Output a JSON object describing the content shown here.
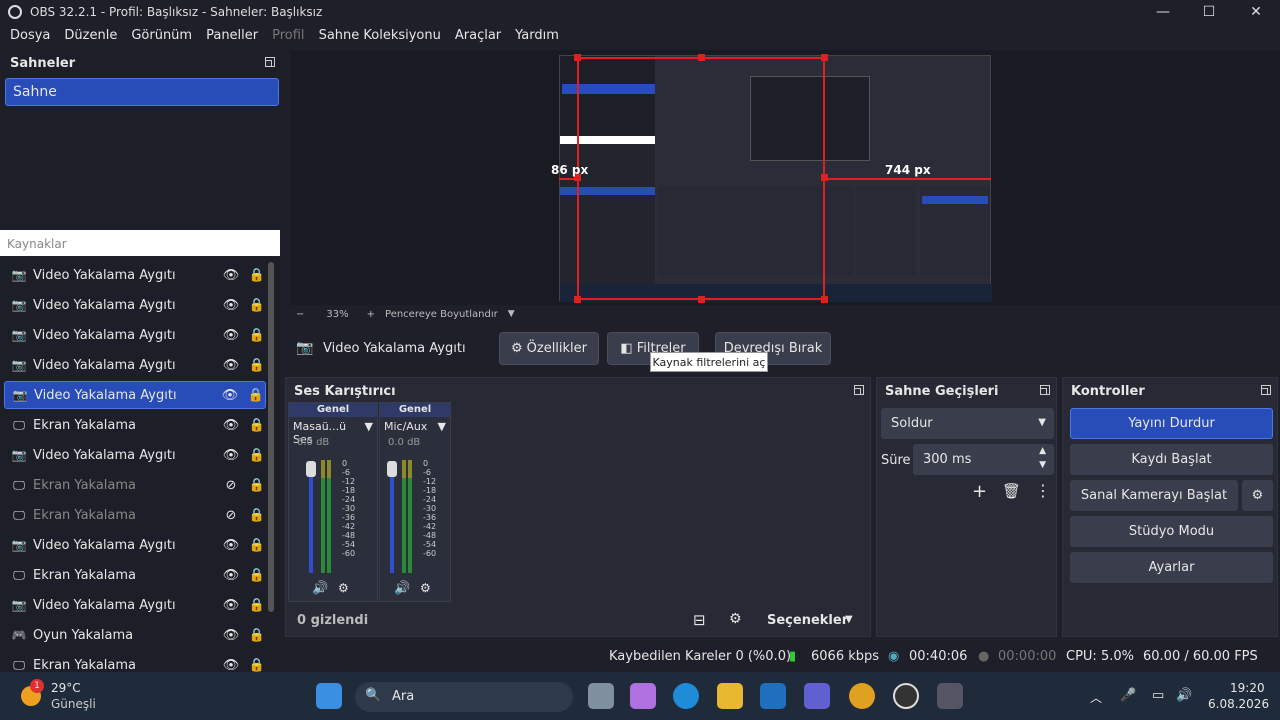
{
  "window": {
    "title": "OBS 32.2.1 - Profil: Başlıksız - Sahneler: Başlıksız"
  },
  "menu": [
    "Dosya",
    "Düzenle",
    "Görünüm",
    "Paneller",
    "Profil",
    "Sahne Koleksiyonu",
    "Araçlar",
    "Yardım"
  ],
  "scenes": {
    "title": "Sahneler",
    "items": [
      "Sahne"
    ]
  },
  "sources": {
    "title": "Kaynaklar",
    "items": [
      {
        "label": "Video Yakalama Aygıtı",
        "icon": "camera-icon"
      },
      {
        "label": "Video Yakalama Aygıtı",
        "icon": "camera-icon"
      },
      {
        "label": "Video Yakalama Aygıtı",
        "icon": "camera-icon"
      },
      {
        "label": "Video Yakalama Aygıtı",
        "icon": "camera-icon"
      },
      {
        "label": "Video Yakalama Aygıtı",
        "icon": "camera-icon",
        "selected": true
      },
      {
        "label": "Ekran Yakalama",
        "icon": "monitor-icon"
      },
      {
        "label": "Video Yakalama Aygıtı",
        "icon": "camera-icon"
      },
      {
        "label": "Ekran Yakalama",
        "icon": "monitor-icon",
        "hidden": true
      },
      {
        "label": "Ekran Yakalama",
        "icon": "monitor-icon",
        "hidden": true
      },
      {
        "label": "Video Yakalama Aygıtı",
        "icon": "camera-icon"
      },
      {
        "label": "Ekran Yakalama",
        "icon": "monitor-icon"
      },
      {
        "label": "Video Yakalama Aygıtı",
        "icon": "camera-icon"
      },
      {
        "label": "Oyun Yakalama",
        "icon": "gamepad-icon"
      },
      {
        "label": "Ekran Yakalama",
        "icon": "monitor-icon"
      }
    ]
  },
  "preview": {
    "label_left": "86 px",
    "label_right": "744 px"
  },
  "zoom": {
    "minus": "−",
    "value": "33%",
    "plus": "+",
    "fit": "Pencereye Boyutlandır"
  },
  "source_bar": {
    "name": "Video Yakalama Aygıtı",
    "properties": "Özellikler",
    "filters": "Filtreler",
    "disable": "Devredışı Bırak",
    "tooltip": "Kaynak filtrelerini aç"
  },
  "mixer": {
    "title": "Ses Karıştırıcı",
    "channels": [
      {
        "header": "Genel",
        "name": "Masaü...ü Ses",
        "db": "0.0 dB"
      },
      {
        "header": "Genel",
        "name": "Mic/Aux",
        "db": "0.0 dB"
      }
    ],
    "scale": [
      "0",
      "-6",
      "-12",
      "-18",
      "-24",
      "-30",
      "-36",
      "-42",
      "-48",
      "-54",
      "-60"
    ],
    "hidden": "0 gizlendi",
    "options": "Seçenekler"
  },
  "transitions": {
    "title": "Sahne Geçişleri",
    "type": "Soldur",
    "duration_label": "Süre",
    "duration": "300 ms"
  },
  "controls": {
    "title": "Kontroller",
    "buttons": [
      "Yayını Durdur",
      "Kaydı Başlat",
      "Sanal Kamerayı Başlat",
      "Stüdyo Modu",
      "Ayarlar"
    ]
  },
  "status": {
    "dropped": "Kaybedilen Kareler 0 (%0.0)",
    "bitrate": "6066 kbps",
    "stream_time": "00:40:06",
    "rec_time": "00:00:00",
    "cpu": "CPU: 5.0%",
    "fps": "60.00 / 60.00 FPS"
  },
  "taskbar": {
    "weather_temp": "29°C",
    "weather_desc": "Güneşli",
    "badge": "1",
    "search": "Ara",
    "time": "19:20",
    "date": "6.08.2026"
  },
  "colors": {
    "accent": "#284cb8",
    "selection_border": "#4b78e6",
    "red": "#e02020"
  }
}
